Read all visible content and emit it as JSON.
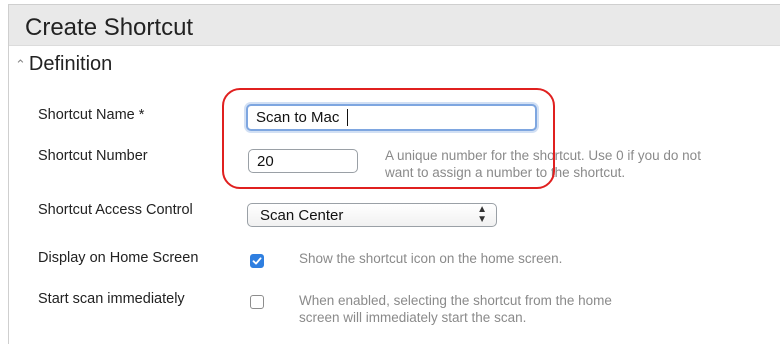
{
  "header": {
    "title": "Create Shortcut"
  },
  "section": {
    "label": "Definition",
    "icon": "double-chevron-up-icon"
  },
  "fields": {
    "shortcut_name": {
      "label": "Shortcut Name *",
      "value": "Scan to Mac "
    },
    "shortcut_number": {
      "label": "Shortcut Number",
      "value": "20",
      "help_line1": "A unique number for the shortcut. Use 0 if you do not",
      "help_line2": "want to assign a number to the shortcut."
    },
    "access_control": {
      "label": "Shortcut Access Control",
      "selected": "Scan Center"
    },
    "display_home": {
      "label": "Display on Home Screen",
      "checked": true,
      "help": "Show the shortcut icon on the home screen."
    },
    "start_scan": {
      "label": "Start scan immediately",
      "checked": false,
      "help_line1": "When enabled, selecting the shortcut from the home",
      "help_line2": "screen will immediately start the scan."
    }
  },
  "colors": {
    "header_bg": "#e9e9e9",
    "focus_ring": "#7ea6e0",
    "checkbox_checked": "#2f7fe0",
    "annotation": "#e0201f",
    "help_text": "#8a8a8a"
  }
}
